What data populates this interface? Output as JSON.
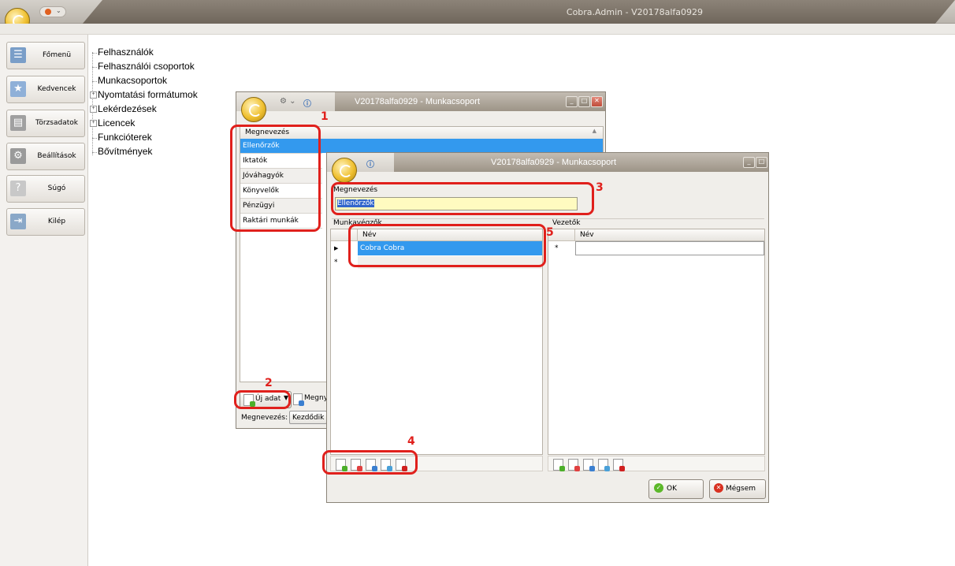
{
  "app": {
    "title": "Cobra.Admin - V20178alfa0929"
  },
  "nav": [
    {
      "label": "Főmenü",
      "icon": "list-icon",
      "color": "#7a9ec8"
    },
    {
      "label": "Kedvencek",
      "icon": "star-icon",
      "color": "#8fb0d8"
    },
    {
      "label": "Törzsadatok",
      "icon": "table-icon",
      "color": "#909090"
    },
    {
      "label": "Beállítások",
      "icon": "gear-icon",
      "color": "#9a9a9a"
    },
    {
      "label": "Súgó",
      "icon": "question-icon",
      "color": "#c0c0c0"
    },
    {
      "label": "Kilép",
      "icon": "exit-icon",
      "color": "#8aa8c8"
    }
  ],
  "tree": [
    {
      "label": "Felhasználók",
      "expandable": false
    },
    {
      "label": "Felhasználói csoportok",
      "expandable": false
    },
    {
      "label": "Munkacsoportok",
      "expandable": false
    },
    {
      "label": "Nyomtatási formátumok",
      "expandable": true
    },
    {
      "label": "Lekérdezések",
      "expandable": true
    },
    {
      "label": "Licencek",
      "expandable": true
    },
    {
      "label": "Funkcióterek",
      "expandable": false
    },
    {
      "label": "Bővítmények",
      "expandable": false
    }
  ],
  "list_window": {
    "title": "V20178alfa0929 - Munkacsoport",
    "column": "Megnevezés",
    "rows": [
      "Ellenőrzők",
      "Iktatók",
      "Jóváhagyók",
      "Könyvelők",
      "Pénzügyi munkacsoport",
      "Raktári munkák"
    ],
    "selected": 0,
    "new_button": "Új adat",
    "next_button_partial": "Megny",
    "filter_label": "Megnevezés:",
    "filter_value": "Kezdődik"
  },
  "edit_window": {
    "title": "V20178alfa0929 - Munkacsoport",
    "name_label": "Megnevezés",
    "name_value": "Ellenőrzők",
    "workers_label": "Munkavégzők",
    "workers_column": "Név",
    "workers_rows": [
      "Cobra Cobra"
    ],
    "leaders_label": "Vezetők",
    "leaders_column": "Név",
    "ok": "OK",
    "cancel": "Mégsem"
  },
  "annotations": [
    "1",
    "2",
    "3",
    "4",
    "5"
  ],
  "colors": {
    "annotation": "#e0201c",
    "selection": "#3399ee",
    "input_highlight": "#fffbc0"
  }
}
